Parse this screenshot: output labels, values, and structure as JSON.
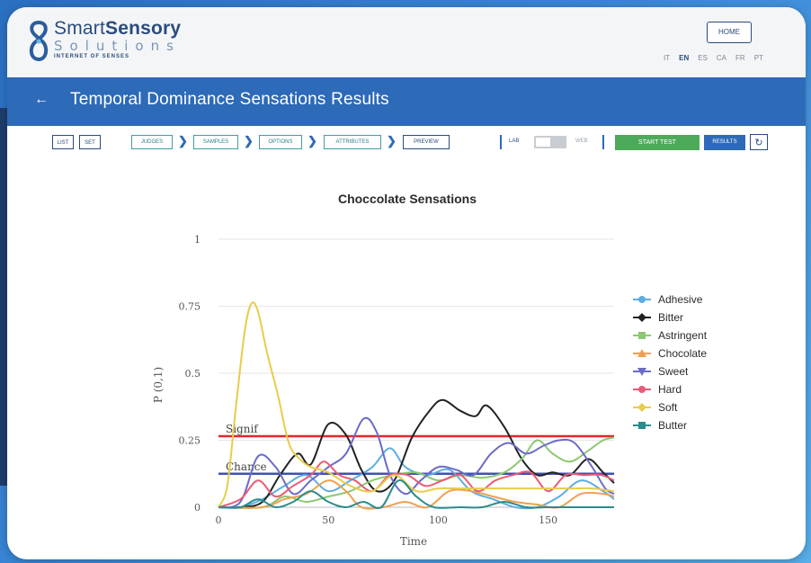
{
  "header": {
    "brand_name_part1": "Smart",
    "brand_name_part2": "Sensory",
    "brand_sub": "Solutions",
    "brand_tagline": "INTERNET OF SENSES",
    "home_label": "HOME",
    "languages": [
      {
        "code": "IT",
        "active": false
      },
      {
        "code": "EN",
        "active": true
      },
      {
        "code": "ES",
        "active": false
      },
      {
        "code": "CA",
        "active": false
      },
      {
        "code": "FR",
        "active": false
      },
      {
        "code": "PT",
        "active": false
      }
    ]
  },
  "titlebar": {
    "back_icon": "arrow-left-icon",
    "title": "Temporal Dominance Sensations Results"
  },
  "toolbar": {
    "list_label": "LIST",
    "set_label": "SET",
    "steps": [
      "JUDGES",
      "SAMPLES",
      "OPTIONS",
      "ATTRIBUTES",
      "PREVIEW"
    ],
    "lab_label": "LAB",
    "web_label": "WEB",
    "start_test_label": "START TEST",
    "results_label": "RESULTS",
    "refresh_icon": "refresh-icon"
  },
  "colors": {
    "brand_blue": "#2d6ab8",
    "start_green": "#4caa5a",
    "signif_line": "#e8262a",
    "chance_line": "#3f51b5"
  },
  "chart_data": {
    "type": "line",
    "title": "Choccolate Sensations",
    "xlabel": "Time",
    "ylabel": "P (0,1)",
    "xlim": [
      0,
      180
    ],
    "ylim": [
      0,
      1
    ],
    "x_ticks": [
      0,
      50,
      100,
      150
    ],
    "y_ticks": [
      0,
      0.25,
      0.5,
      0.75,
      1
    ],
    "y_tick_labels": [
      "0",
      "0.25",
      "0.5",
      "0.75",
      "1"
    ],
    "grid": "horizontal",
    "legend_position": "right",
    "reference_lines": [
      {
        "label": "Signif",
        "y": 0.265,
        "color": "#e8262a"
      },
      {
        "label": "Chance",
        "y": 0.125,
        "color": "#3f51b5"
      }
    ],
    "series": [
      {
        "name": "Adhesive",
        "color": "#5dade2",
        "marker": "circle",
        "points": [
          [
            0,
            0
          ],
          [
            10,
            0
          ],
          [
            20,
            0.03
          ],
          [
            30,
            0.08
          ],
          [
            40,
            0.12
          ],
          [
            50,
            0.06
          ],
          [
            60,
            0.1
          ],
          [
            70,
            0.15
          ],
          [
            78,
            0.22
          ],
          [
            85,
            0.15
          ],
          [
            95,
            0.12
          ],
          [
            105,
            0.14
          ],
          [
            115,
            0.06
          ],
          [
            125,
            0.03
          ],
          [
            135,
            0
          ],
          [
            145,
            0
          ],
          [
            155,
            0.04
          ],
          [
            165,
            0.1
          ],
          [
            175,
            0.06
          ],
          [
            180,
            0.03
          ]
        ]
      },
      {
        "name": "Bitter",
        "color": "#222222",
        "marker": "diamond",
        "points": [
          [
            0,
            0
          ],
          [
            10,
            0
          ],
          [
            20,
            0.02
          ],
          [
            28,
            0.12
          ],
          [
            36,
            0.2
          ],
          [
            42,
            0.16
          ],
          [
            50,
            0.31
          ],
          [
            58,
            0.27
          ],
          [
            65,
            0.14
          ],
          [
            72,
            0.06
          ],
          [
            80,
            0.1
          ],
          [
            88,
            0.26
          ],
          [
            96,
            0.36
          ],
          [
            102,
            0.4
          ],
          [
            110,
            0.36
          ],
          [
            117,
            0.34
          ],
          [
            122,
            0.38
          ],
          [
            130,
            0.3
          ],
          [
            138,
            0.18
          ],
          [
            145,
            0.12
          ],
          [
            152,
            0.13
          ],
          [
            160,
            0.12
          ],
          [
            168,
            0.18
          ],
          [
            175,
            0.13
          ],
          [
            180,
            0.09
          ]
        ]
      },
      {
        "name": "Astringent",
        "color": "#8cc873",
        "marker": "square",
        "points": [
          [
            0,
            0
          ],
          [
            20,
            0
          ],
          [
            30,
            0.04
          ],
          [
            40,
            0.02
          ],
          [
            50,
            0.04
          ],
          [
            60,
            0.06
          ],
          [
            70,
            0.1
          ],
          [
            80,
            0.12
          ],
          [
            90,
            0.13
          ],
          [
            100,
            0.1
          ],
          [
            110,
            0.12
          ],
          [
            120,
            0.11
          ],
          [
            130,
            0.13
          ],
          [
            138,
            0.18
          ],
          [
            145,
            0.25
          ],
          [
            152,
            0.2
          ],
          [
            160,
            0.17
          ],
          [
            168,
            0.21
          ],
          [
            175,
            0.25
          ],
          [
            180,
            0.26
          ]
        ]
      },
      {
        "name": "Chocolate",
        "color": "#f0a050",
        "marker": "triangle",
        "points": [
          [
            0,
            0
          ],
          [
            20,
            0
          ],
          [
            30,
            0.03
          ],
          [
            40,
            0.05
          ],
          [
            50,
            0.1
          ],
          [
            58,
            0.06
          ],
          [
            65,
            0.0
          ],
          [
            75,
            0.0
          ],
          [
            85,
            0.02
          ],
          [
            95,
            0.0
          ],
          [
            105,
            0.06
          ],
          [
            115,
            0.06
          ],
          [
            125,
            0.04
          ],
          [
            135,
            0.02
          ],
          [
            145,
            0.01
          ],
          [
            155,
            0.0
          ],
          [
            165,
            0.05
          ],
          [
            175,
            0.05
          ],
          [
            180,
            0.04
          ]
        ]
      },
      {
        "name": "Sweet",
        "color": "#6b6bc8",
        "marker": "triangle-down",
        "points": [
          [
            0,
            0
          ],
          [
            10,
            0.02
          ],
          [
            18,
            0.19
          ],
          [
            26,
            0.15
          ],
          [
            34,
            0.05
          ],
          [
            42,
            0.1
          ],
          [
            50,
            0.15
          ],
          [
            58,
            0.2
          ],
          [
            66,
            0.33
          ],
          [
            72,
            0.28
          ],
          [
            78,
            0.12
          ],
          [
            85,
            0.05
          ],
          [
            92,
            0.1
          ],
          [
            100,
            0.15
          ],
          [
            108,
            0.14
          ],
          [
            116,
            0.12
          ],
          [
            124,
            0.2
          ],
          [
            132,
            0.24
          ],
          [
            140,
            0.2
          ],
          [
            148,
            0.23
          ],
          [
            155,
            0.25
          ],
          [
            162,
            0.24
          ],
          [
            170,
            0.15
          ],
          [
            176,
            0.07
          ],
          [
            180,
            0.05
          ]
        ]
      },
      {
        "name": "Hard",
        "color": "#ec5a76",
        "marker": "circle",
        "points": [
          [
            0,
            0
          ],
          [
            10,
            0.03
          ],
          [
            18,
            0.1
          ],
          [
            26,
            0.04
          ],
          [
            34,
            0.08
          ],
          [
            42,
            0.12
          ],
          [
            48,
            0.17
          ],
          [
            55,
            0.12
          ],
          [
            62,
            0.1
          ],
          [
            70,
            0.06
          ],
          [
            78,
            0.12
          ],
          [
            86,
            0.12
          ],
          [
            94,
            0.08
          ],
          [
            102,
            0.1
          ],
          [
            110,
            0.12
          ],
          [
            118,
            0.06
          ],
          [
            126,
            0.1
          ],
          [
            134,
            0.12
          ],
          [
            142,
            0.13
          ],
          [
            150,
            0.06
          ],
          [
            158,
            0.12
          ],
          [
            166,
            0.12
          ],
          [
            174,
            0.12
          ],
          [
            180,
            0.1
          ]
        ]
      },
      {
        "name": "Soft",
        "color": "#e8cc4a",
        "marker": "diamond",
        "points": [
          [
            0,
            0
          ],
          [
            4,
            0.08
          ],
          [
            8,
            0.38
          ],
          [
            12,
            0.66
          ],
          [
            15,
            0.76
          ],
          [
            18,
            0.73
          ],
          [
            22,
            0.58
          ],
          [
            27,
            0.42
          ],
          [
            32,
            0.24
          ],
          [
            37,
            0.18
          ],
          [
            42,
            0.15
          ],
          [
            50,
            0.13
          ],
          [
            60,
            0.08
          ],
          [
            70,
            0.06
          ],
          [
            80,
            0.12
          ],
          [
            90,
            0.06
          ],
          [
            100,
            0.07
          ],
          [
            110,
            0.07
          ],
          [
            120,
            0.07
          ],
          [
            130,
            0.07
          ],
          [
            140,
            0.07
          ],
          [
            150,
            0.07
          ],
          [
            160,
            0.07
          ],
          [
            170,
            0.07
          ],
          [
            180,
            0.06
          ]
        ]
      },
      {
        "name": "Butter",
        "color": "#2a8c8c",
        "marker": "square",
        "points": [
          [
            0,
            0
          ],
          [
            10,
            0
          ],
          [
            18,
            0.03
          ],
          [
            26,
            0.0
          ],
          [
            34,
            0.02
          ],
          [
            42,
            0.06
          ],
          [
            50,
            0.02
          ],
          [
            58,
            0.0
          ],
          [
            66,
            0.02
          ],
          [
            74,
            0.0
          ],
          [
            82,
            0.1
          ],
          [
            90,
            0.04
          ],
          [
            98,
            0.0
          ],
          [
            110,
            0.0
          ],
          [
            120,
            0.0
          ],
          [
            130,
            0.02
          ],
          [
            140,
            0.0
          ],
          [
            150,
            0.0
          ],
          [
            160,
            0.0
          ],
          [
            170,
            0.0
          ],
          [
            180,
            0.0
          ]
        ]
      }
    ]
  }
}
